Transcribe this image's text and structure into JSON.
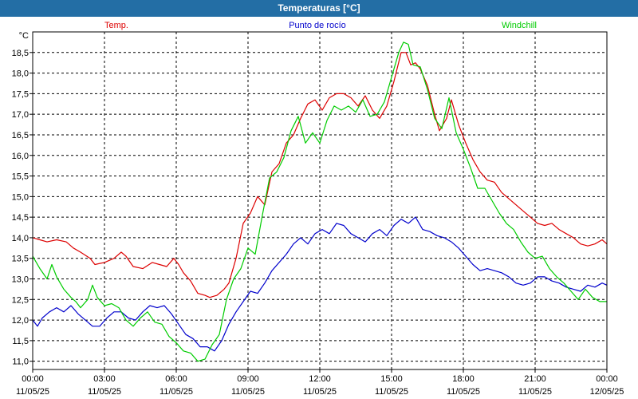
{
  "window": {
    "title": "Temperaturas [°C]"
  },
  "chart_data": {
    "type": "line",
    "unit_label": "°C",
    "grid": true,
    "legend_placement": "top",
    "ylim": [
      10.8,
      19.0
    ],
    "xlim_hours": [
      0,
      24
    ],
    "y_ticks": [
      "11,0",
      "11,5",
      "12,0",
      "12,5",
      "13,0",
      "13,5",
      "14,0",
      "14,5",
      "15,0",
      "15,5",
      "16,0",
      "16,5",
      "17,0",
      "17,5",
      "18,0",
      "18,5"
    ],
    "x_ticks": [
      {
        "time": "00:00",
        "date": "11/05/25"
      },
      {
        "time": "03:00",
        "date": "11/05/25"
      },
      {
        "time": "06:00",
        "date": "11/05/25"
      },
      {
        "time": "09:00",
        "date": "11/05/25"
      },
      {
        "time": "12:00",
        "date": "11/05/25"
      },
      {
        "time": "15:00",
        "date": "11/05/25"
      },
      {
        "time": "18:00",
        "date": "11/05/25"
      },
      {
        "time": "21:00",
        "date": "11/05/25"
      },
      {
        "time": "00:00",
        "date": "12/05/25"
      }
    ],
    "series": [
      {
        "name": "Temp.",
        "color": "#dd0000",
        "points": [
          [
            0,
            14.0
          ],
          [
            0.3,
            13.95
          ],
          [
            0.6,
            13.9
          ],
          [
            1,
            13.95
          ],
          [
            1.4,
            13.9
          ],
          [
            1.7,
            13.75
          ],
          [
            2,
            13.65
          ],
          [
            2.4,
            13.5
          ],
          [
            2.6,
            13.35
          ],
          [
            3,
            13.4
          ],
          [
            3.4,
            13.5
          ],
          [
            3.7,
            13.65
          ],
          [
            3.9,
            13.55
          ],
          [
            4.2,
            13.3
          ],
          [
            4.6,
            13.25
          ],
          [
            5,
            13.4
          ],
          [
            5.3,
            13.35
          ],
          [
            5.6,
            13.3
          ],
          [
            5.9,
            13.5
          ],
          [
            6.1,
            13.35
          ],
          [
            6.3,
            13.15
          ],
          [
            6.6,
            12.95
          ],
          [
            6.9,
            12.65
          ],
          [
            7.2,
            12.6
          ],
          [
            7.4,
            12.55
          ],
          [
            7.7,
            12.6
          ],
          [
            8,
            12.75
          ],
          [
            8.2,
            12.9
          ],
          [
            8.5,
            13.5
          ],
          [
            8.8,
            14.35
          ],
          [
            9.1,
            14.6
          ],
          [
            9.4,
            15.0
          ],
          [
            9.7,
            14.8
          ],
          [
            10,
            15.6
          ],
          [
            10.3,
            15.8
          ],
          [
            10.6,
            16.3
          ],
          [
            10.9,
            16.5
          ],
          [
            11.2,
            16.9
          ],
          [
            11.5,
            17.25
          ],
          [
            11.8,
            17.35
          ],
          [
            12.1,
            17.1
          ],
          [
            12.4,
            17.4
          ],
          [
            12.7,
            17.5
          ],
          [
            13,
            17.5
          ],
          [
            13.3,
            17.4
          ],
          [
            13.6,
            17.2
          ],
          [
            13.9,
            17.45
          ],
          [
            14.2,
            17.1
          ],
          [
            14.5,
            16.9
          ],
          [
            14.8,
            17.2
          ],
          [
            15.1,
            17.8
          ],
          [
            15.4,
            18.5
          ],
          [
            15.6,
            18.5
          ],
          [
            15.8,
            18.2
          ],
          [
            16.0,
            18.25
          ],
          [
            16.2,
            18.1
          ],
          [
            16.5,
            17.7
          ],
          [
            16.8,
            17.0
          ],
          [
            17.0,
            16.6
          ],
          [
            17.3,
            16.9
          ],
          [
            17.5,
            17.35
          ],
          [
            17.8,
            16.75
          ],
          [
            18.1,
            16.3
          ],
          [
            18.4,
            15.9
          ],
          [
            18.7,
            15.6
          ],
          [
            19,
            15.4
          ],
          [
            19.3,
            15.35
          ],
          [
            19.6,
            15.1
          ],
          [
            19.9,
            14.95
          ],
          [
            20.2,
            14.8
          ],
          [
            20.5,
            14.65
          ],
          [
            20.8,
            14.5
          ],
          [
            21.1,
            14.35
          ],
          [
            21.4,
            14.3
          ],
          [
            21.7,
            14.35
          ],
          [
            22,
            14.2
          ],
          [
            22.3,
            14.1
          ],
          [
            22.6,
            14.0
          ],
          [
            22.9,
            13.85
          ],
          [
            23.2,
            13.8
          ],
          [
            23.5,
            13.85
          ],
          [
            23.8,
            13.95
          ],
          [
            24,
            13.85
          ]
        ]
      },
      {
        "name": "Punto de rocío",
        "color": "#0000cc",
        "points": [
          [
            0,
            12.0
          ],
          [
            0.2,
            11.85
          ],
          [
            0.4,
            12.05
          ],
          [
            0.7,
            12.2
          ],
          [
            1,
            12.3
          ],
          [
            1.3,
            12.2
          ],
          [
            1.6,
            12.35
          ],
          [
            1.9,
            12.15
          ],
          [
            2.2,
            12.0
          ],
          [
            2.5,
            11.85
          ],
          [
            2.8,
            11.85
          ],
          [
            3.1,
            12.05
          ],
          [
            3.4,
            12.2
          ],
          [
            3.7,
            12.2
          ],
          [
            4.0,
            12.05
          ],
          [
            4.3,
            12.0
          ],
          [
            4.6,
            12.2
          ],
          [
            4.9,
            12.35
          ],
          [
            5.2,
            12.3
          ],
          [
            5.5,
            12.35
          ],
          [
            5.8,
            12.15
          ],
          [
            6.1,
            11.9
          ],
          [
            6.4,
            11.65
          ],
          [
            6.7,
            11.55
          ],
          [
            7.0,
            11.35
          ],
          [
            7.3,
            11.35
          ],
          [
            7.6,
            11.25
          ],
          [
            7.9,
            11.5
          ],
          [
            8.2,
            11.9
          ],
          [
            8.5,
            12.2
          ],
          [
            8.8,
            12.45
          ],
          [
            9.1,
            12.7
          ],
          [
            9.4,
            12.65
          ],
          [
            9.7,
            12.9
          ],
          [
            10,
            13.2
          ],
          [
            10.3,
            13.4
          ],
          [
            10.6,
            13.6
          ],
          [
            10.9,
            13.85
          ],
          [
            11.2,
            14.0
          ],
          [
            11.5,
            13.85
          ],
          [
            11.8,
            14.1
          ],
          [
            12.1,
            14.2
          ],
          [
            12.4,
            14.1
          ],
          [
            12.7,
            14.35
          ],
          [
            13,
            14.3
          ],
          [
            13.3,
            14.1
          ],
          [
            13.6,
            14.0
          ],
          [
            13.9,
            13.9
          ],
          [
            14.2,
            14.1
          ],
          [
            14.5,
            14.2
          ],
          [
            14.8,
            14.05
          ],
          [
            15.1,
            14.3
          ],
          [
            15.4,
            14.45
          ],
          [
            15.7,
            14.35
          ],
          [
            16,
            14.5
          ],
          [
            16.3,
            14.2
          ],
          [
            16.6,
            14.15
          ],
          [
            16.9,
            14.05
          ],
          [
            17.2,
            14.0
          ],
          [
            17.5,
            13.9
          ],
          [
            17.8,
            13.75
          ],
          [
            18.1,
            13.55
          ],
          [
            18.4,
            13.35
          ],
          [
            18.7,
            13.2
          ],
          [
            19,
            13.25
          ],
          [
            19.3,
            13.2
          ],
          [
            19.6,
            13.15
          ],
          [
            19.9,
            13.05
          ],
          [
            20.2,
            12.9
          ],
          [
            20.5,
            12.85
          ],
          [
            20.8,
            12.9
          ],
          [
            21.1,
            13.05
          ],
          [
            21.4,
            13.05
          ],
          [
            21.7,
            12.95
          ],
          [
            22,
            12.9
          ],
          [
            22.3,
            12.8
          ],
          [
            22.6,
            12.75
          ],
          [
            22.9,
            12.7
          ],
          [
            23.2,
            12.85
          ],
          [
            23.5,
            12.8
          ],
          [
            23.8,
            12.9
          ],
          [
            24,
            12.85
          ]
        ]
      },
      {
        "name": "Windchill",
        "color": "#00cc00",
        "points": [
          [
            0,
            13.55
          ],
          [
            0.3,
            13.25
          ],
          [
            0.6,
            13.0
          ],
          [
            0.8,
            13.35
          ],
          [
            1,
            13.05
          ],
          [
            1.3,
            12.75
          ],
          [
            1.6,
            12.55
          ],
          [
            1.8,
            12.45
          ],
          [
            2.0,
            12.3
          ],
          [
            2.3,
            12.5
          ],
          [
            2.5,
            12.85
          ],
          [
            2.7,
            12.55
          ],
          [
            3,
            12.35
          ],
          [
            3.3,
            12.4
          ],
          [
            3.6,
            12.3
          ],
          [
            3.9,
            12.0
          ],
          [
            4.2,
            11.85
          ],
          [
            4.5,
            12.05
          ],
          [
            4.8,
            12.2
          ],
          [
            5.1,
            11.95
          ],
          [
            5.4,
            11.9
          ],
          [
            5.7,
            11.6
          ],
          [
            6.0,
            11.45
          ],
          [
            6.3,
            11.25
          ],
          [
            6.6,
            11.2
          ],
          [
            6.9,
            11.0
          ],
          [
            7.2,
            11.05
          ],
          [
            7.5,
            11.4
          ],
          [
            7.8,
            11.65
          ],
          [
            8.1,
            12.5
          ],
          [
            8.4,
            13.0
          ],
          [
            8.7,
            13.25
          ],
          [
            9.0,
            13.75
          ],
          [
            9.3,
            13.6
          ],
          [
            9.6,
            14.55
          ],
          [
            9.9,
            15.45
          ],
          [
            10.2,
            15.6
          ],
          [
            10.5,
            15.95
          ],
          [
            10.8,
            16.6
          ],
          [
            11.1,
            16.95
          ],
          [
            11.4,
            16.3
          ],
          [
            11.7,
            16.55
          ],
          [
            12.0,
            16.3
          ],
          [
            12.3,
            16.85
          ],
          [
            12.6,
            17.2
          ],
          [
            12.9,
            17.1
          ],
          [
            13.2,
            17.2
          ],
          [
            13.5,
            17.05
          ],
          [
            13.8,
            17.35
          ],
          [
            14.1,
            16.95
          ],
          [
            14.4,
            17.0
          ],
          [
            14.7,
            17.3
          ],
          [
            15.0,
            17.9
          ],
          [
            15.3,
            18.5
          ],
          [
            15.5,
            18.75
          ],
          [
            15.7,
            18.7
          ],
          [
            15.9,
            18.2
          ],
          [
            16.2,
            18.15
          ],
          [
            16.5,
            17.6
          ],
          [
            16.8,
            16.9
          ],
          [
            17.1,
            16.65
          ],
          [
            17.4,
            17.4
          ],
          [
            17.7,
            16.55
          ],
          [
            18.0,
            16.15
          ],
          [
            18.3,
            15.7
          ],
          [
            18.6,
            15.2
          ],
          [
            18.9,
            15.2
          ],
          [
            19.2,
            14.9
          ],
          [
            19.5,
            14.6
          ],
          [
            19.8,
            14.35
          ],
          [
            20.1,
            14.2
          ],
          [
            20.4,
            13.9
          ],
          [
            20.7,
            13.65
          ],
          [
            21.0,
            13.5
          ],
          [
            21.3,
            13.55
          ],
          [
            21.6,
            13.25
          ],
          [
            21.9,
            13.05
          ],
          [
            22.2,
            12.9
          ],
          [
            22.5,
            12.7
          ],
          [
            22.8,
            12.5
          ],
          [
            23.1,
            12.75
          ],
          [
            23.4,
            12.55
          ],
          [
            23.7,
            12.45
          ],
          [
            24,
            12.45
          ]
        ]
      }
    ]
  }
}
